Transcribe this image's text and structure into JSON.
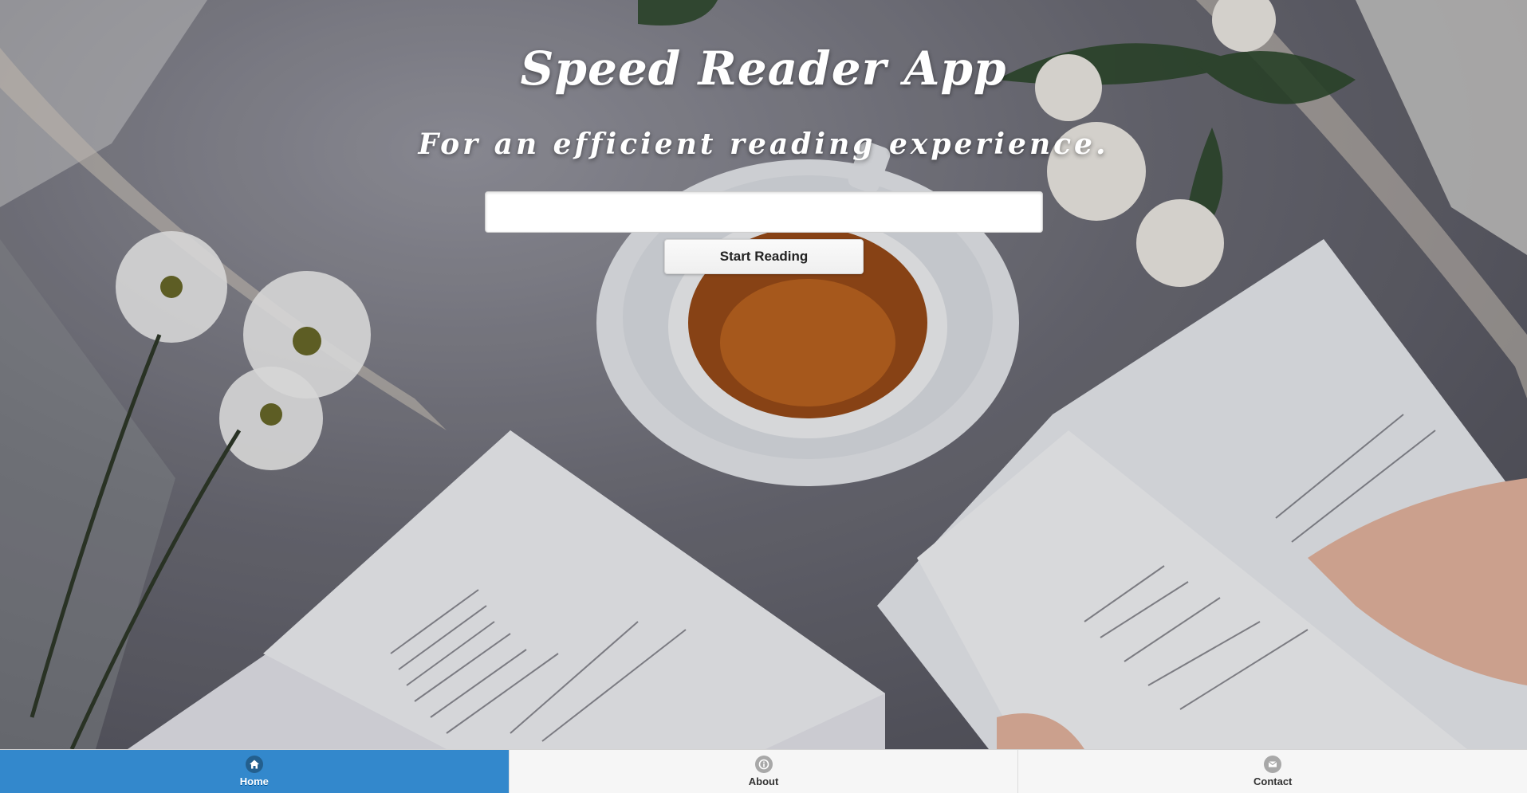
{
  "hero": {
    "title": "Speed Reader App",
    "subtitle": "For an efficient reading experience."
  },
  "reader": {
    "input_value": "",
    "input_placeholder": "",
    "start_button_label": "Start Reading"
  },
  "navbar": {
    "active_color": "#3388cc",
    "items": [
      {
        "label": "Home",
        "icon": "home-icon",
        "active": true
      },
      {
        "label": "About",
        "icon": "info-icon",
        "active": false
      },
      {
        "label": "Contact",
        "icon": "mail-icon",
        "active": false
      }
    ]
  }
}
